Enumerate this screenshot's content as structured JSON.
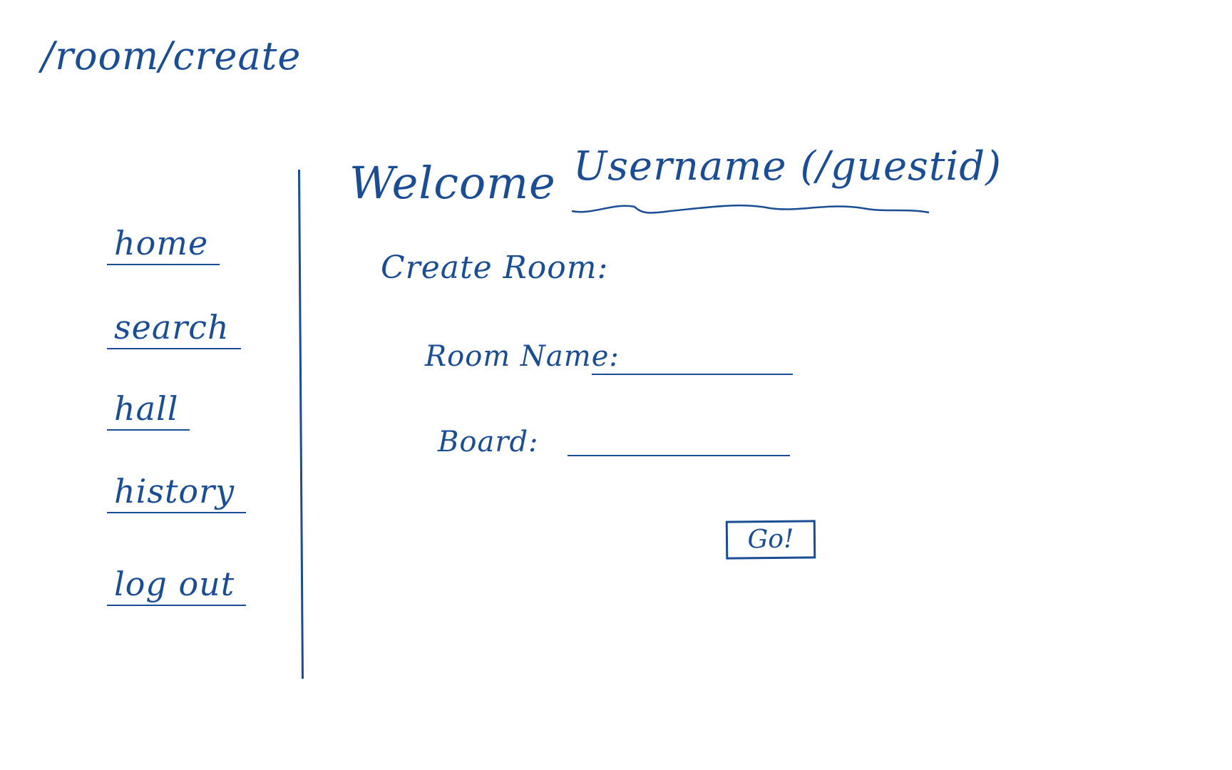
{
  "route": "/room/create",
  "nav": {
    "items": [
      {
        "label": "home"
      },
      {
        "label": "search"
      },
      {
        "label": "hall"
      },
      {
        "label": "history"
      },
      {
        "label": "log out"
      }
    ]
  },
  "header": {
    "welcome": "Welcome",
    "username": "Username (/guestid)"
  },
  "form": {
    "title": "Create Room:",
    "room_name_label": "Room Name:",
    "board_label": "Board:",
    "room_name_value": "",
    "board_value": "",
    "submit_label": "Go!"
  },
  "colors": {
    "ink": "#1a4d94",
    "background": "#ffffff"
  }
}
